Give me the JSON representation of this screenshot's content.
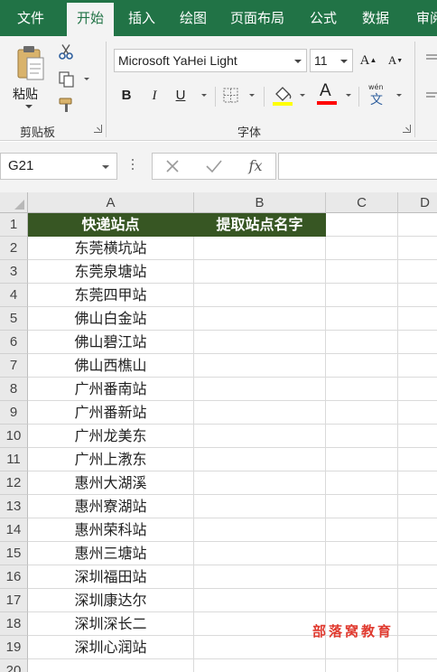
{
  "ribbon": {
    "tabs": [
      {
        "label": "文件",
        "active": false
      },
      {
        "label": "开始",
        "active": true
      },
      {
        "label": "插入",
        "active": false
      },
      {
        "label": "绘图",
        "active": false
      },
      {
        "label": "页面布局",
        "active": false
      },
      {
        "label": "公式",
        "active": false
      },
      {
        "label": "数据",
        "active": false
      },
      {
        "label": "审阅",
        "active": false
      }
    ],
    "clipboard": {
      "paste_label": "粘贴",
      "group_label": "剪贴板"
    },
    "font": {
      "font_name": "Microsoft YaHei Light",
      "font_size": "11",
      "bold_label": "B",
      "italic_label": "I",
      "underline_label": "U",
      "font_color_label": "A",
      "grow_label": "A",
      "shrink_label": "A",
      "phonetic_label": "wén",
      "phonetic_char": "文",
      "group_label": "字体",
      "fill_color": "#ffff00",
      "font_color": "#ff0000"
    }
  },
  "formula_bar": {
    "name_box": "G21",
    "fx_label": "fx",
    "formula": ""
  },
  "sheet": {
    "columns": [
      "A",
      "B",
      "C",
      "D"
    ],
    "header_fill": "#375623",
    "rows": [
      {
        "num": "1",
        "a": "快递站点",
        "b": "提取站点名字"
      },
      {
        "num": "2",
        "a": "东莞横坑站",
        "b": ""
      },
      {
        "num": "3",
        "a": "东莞泉塘站",
        "b": ""
      },
      {
        "num": "4",
        "a": "东莞四甲站",
        "b": ""
      },
      {
        "num": "5",
        "a": "佛山白金站",
        "b": ""
      },
      {
        "num": "6",
        "a": "佛山碧江站",
        "b": ""
      },
      {
        "num": "7",
        "a": "佛山西樵山",
        "b": ""
      },
      {
        "num": "8",
        "a": "广州番南站",
        "b": ""
      },
      {
        "num": "9",
        "a": "广州番新站",
        "b": ""
      },
      {
        "num": "10",
        "a": "广州龙美东",
        "b": ""
      },
      {
        "num": "11",
        "a": "广州上漖东",
        "b": ""
      },
      {
        "num": "12",
        "a": "惠州大湖溪",
        "b": ""
      },
      {
        "num": "13",
        "a": "惠州寮湖站",
        "b": ""
      },
      {
        "num": "14",
        "a": "惠州荣科站",
        "b": ""
      },
      {
        "num": "15",
        "a": "惠州三塘站",
        "b": ""
      },
      {
        "num": "16",
        "a": "深圳福田站",
        "b": ""
      },
      {
        "num": "17",
        "a": "深圳康达尔",
        "b": ""
      },
      {
        "num": "18",
        "a": "深圳深长二",
        "b": ""
      },
      {
        "num": "19",
        "a": "深圳心润站",
        "b": ""
      },
      {
        "num": "20",
        "a": "",
        "b": ""
      }
    ]
  },
  "watermark": "部落窝教育"
}
